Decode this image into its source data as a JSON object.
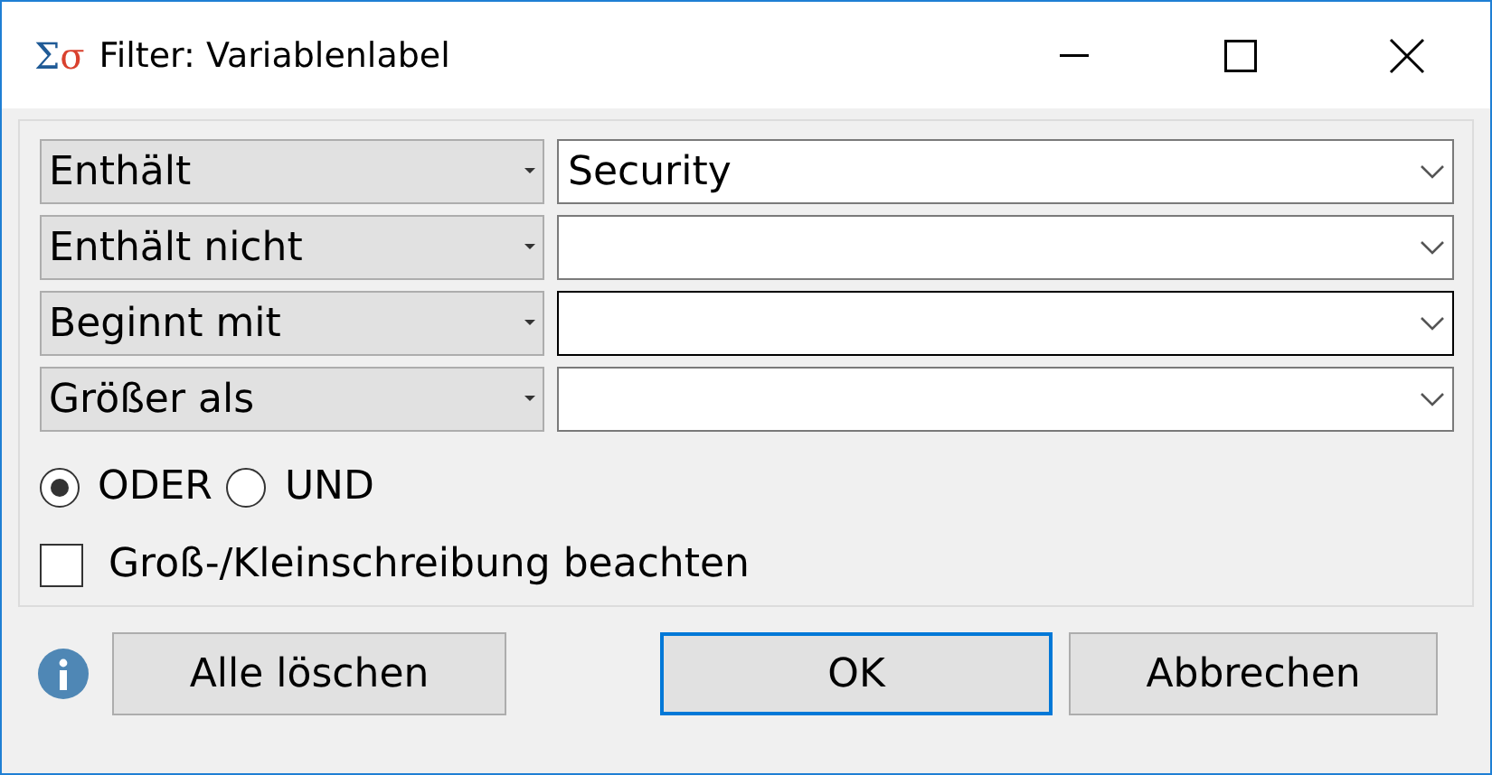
{
  "window": {
    "icon": "Σσ",
    "title": "Filter: Variablenlabel"
  },
  "conditions": [
    {
      "operator": "Enthält",
      "value": "Security",
      "focused": false
    },
    {
      "operator": "Enthält nicht",
      "focused": false
    },
    {
      "operator": "Beginnt mit",
      "focused": true
    },
    {
      "operator": "Größer als",
      "focused": false
    }
  ],
  "logic": [
    {
      "label": "ODER",
      "selected": true
    },
    {
      "label": "UND",
      "selected": false
    }
  ],
  "case_sensitive": {
    "label": "Groß-/Kleinschreibung beachten",
    "checked": false
  },
  "buttons": [
    {
      "label": "Alle löschen",
      "default": false
    },
    {
      "label": "OK",
      "default": true
    },
    {
      "label": "Abbrechen",
      "default": false
    }
  ]
}
